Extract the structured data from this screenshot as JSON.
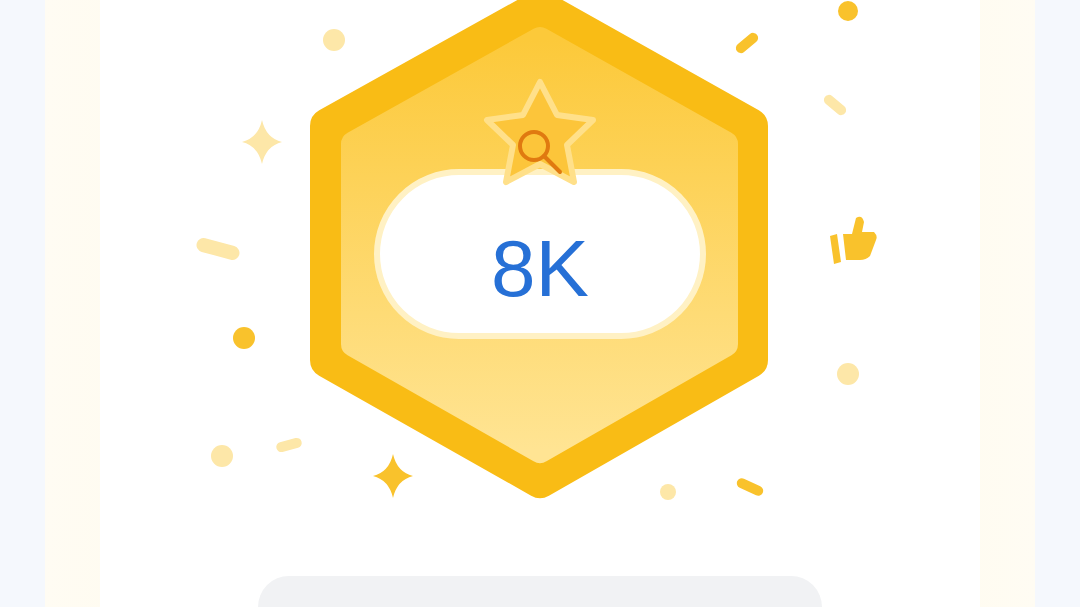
{
  "badge": {
    "value": "8K"
  }
}
